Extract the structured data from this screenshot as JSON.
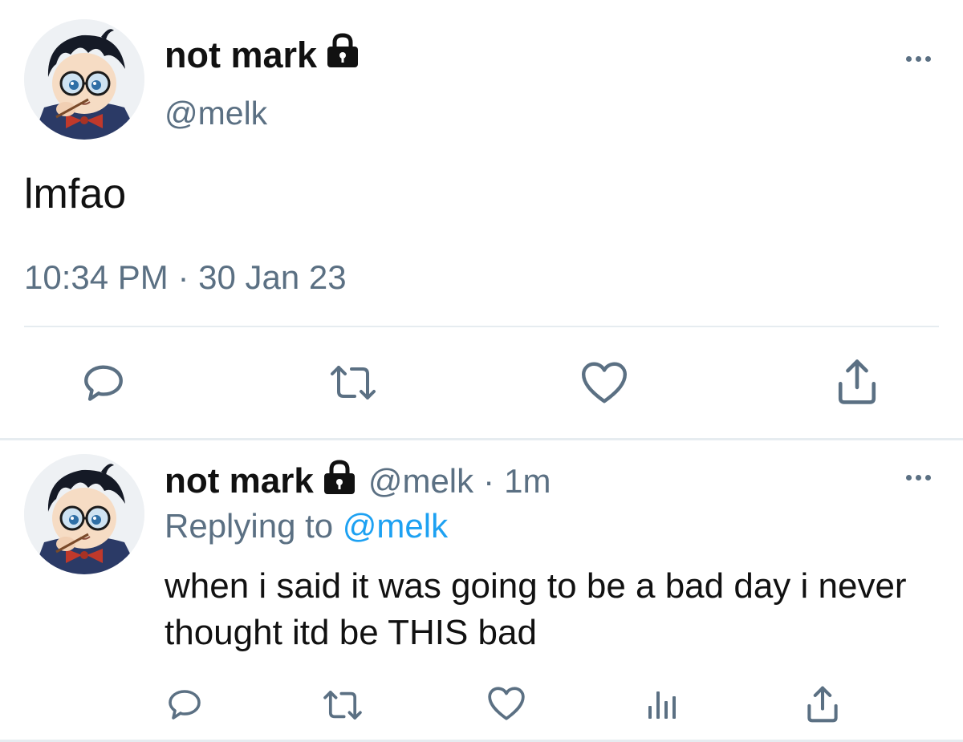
{
  "main_tweet": {
    "display_name": "not mark",
    "handle": "@melk",
    "text": "lmfao",
    "timestamp": "10:34 PM · 30 Jan 23",
    "avatar_icon": "anime-boy-glasses-avatar",
    "protected_icon": "lock-icon",
    "actions": [
      "reply-icon",
      "retweet-icon",
      "like-icon",
      "share-icon"
    ]
  },
  "reply_tweet": {
    "display_name": "not mark",
    "handle": "@melk",
    "separator": "·",
    "relative_time": "1m",
    "replying_prefix": "Replying to",
    "replying_handle": "@melk",
    "text": "when i said it was going to be a bad day i never thought itd be THIS bad",
    "avatar_icon": "anime-boy-glasses-avatar",
    "protected_icon": "lock-icon",
    "actions": [
      "reply-icon",
      "retweet-icon",
      "like-icon",
      "analytics-icon",
      "share-icon"
    ]
  },
  "colors": {
    "text_primary": "#111111",
    "text_secondary": "#5b7083",
    "link": "#1da1f2",
    "divider": "#e6ecf0"
  }
}
